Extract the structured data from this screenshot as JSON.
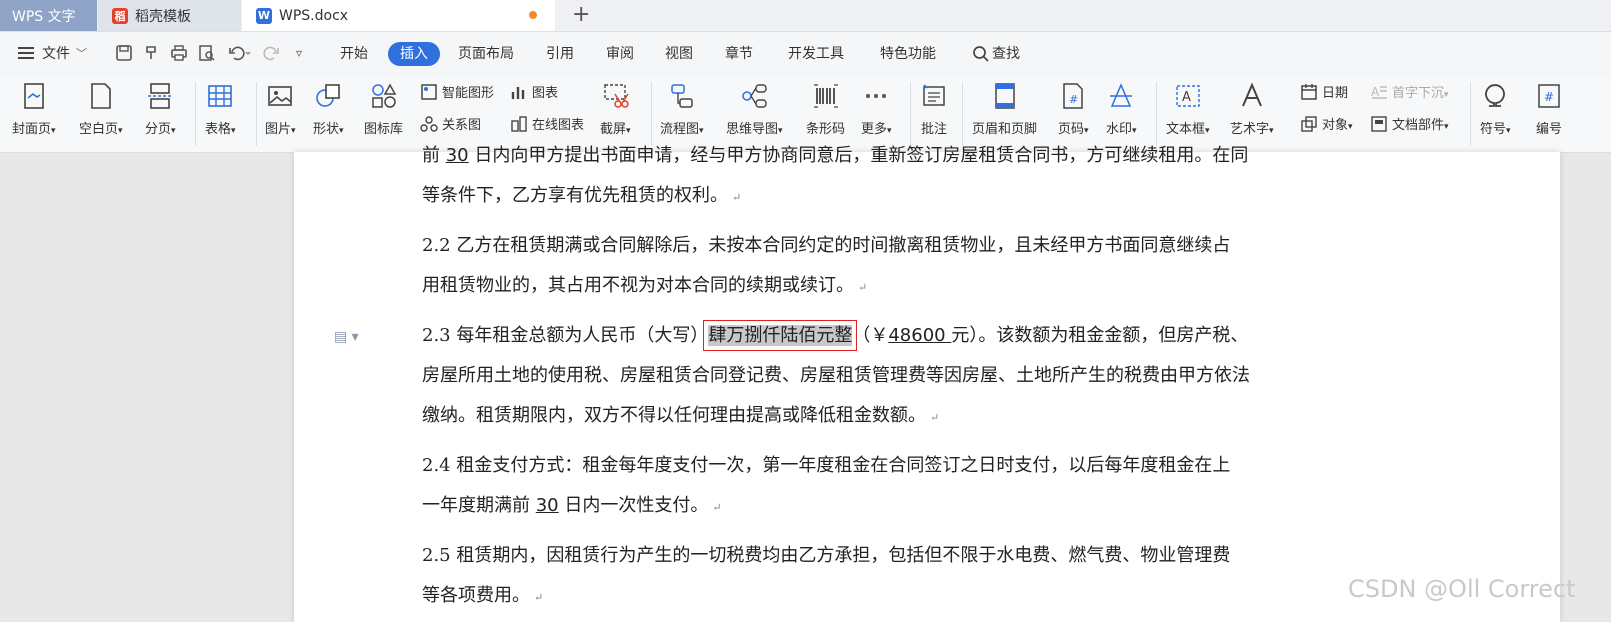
{
  "tabs": {
    "wps": "WPS 文字",
    "template": "稻壳模板",
    "document": "WPS.docx"
  },
  "menubar": {
    "file": "文件",
    "items": [
      "开始",
      "插入",
      "页面布局",
      "引用",
      "审阅",
      "视图",
      "章节",
      "开发工具",
      "特色功能",
      "查找"
    ],
    "active": "插入"
  },
  "ribbon": {
    "cover": "封面页",
    "blank": "空白页",
    "page_break": "分页",
    "table": "表格",
    "picture": "图片",
    "shape": "形状",
    "icon_lib": "图标库",
    "smart_shape": "智能图形",
    "chart": "图表",
    "relation": "关系图",
    "online_chart": "在线图表",
    "screenshot": "截屏",
    "flowchart": "流程图",
    "mindmap": "思维导图",
    "barcode": "条形码",
    "more": "更多",
    "comment": "批注",
    "header_footer": "页眉和页脚",
    "page_number": "页码",
    "watermark": "水印",
    "textbox": "文本框",
    "wordart": "艺术字",
    "date": "日期",
    "dropcap": "首字下沉",
    "object": "对象",
    "doc_parts": "文档部件",
    "symbol": "符号",
    "numbering": "编号"
  },
  "document": {
    "p1_line1_pre": "前 ",
    "p1_line1_num": "30",
    "p1_line1_post": " 日内向甲方提出书面申请，经与甲方协商同意后，重新签订房屋租赁合同书，方可继续租用。在同",
    "p1_line2": "等条件下，乙方享有优先租赁的权利。",
    "p2_line1": "2.2  乙方在租赁期满或合同解除后，未按本合同约定的时间撤离租赁物业，且未经甲方书面同意继续占",
    "p2_line2": "用租赁物业的，其占用不视为对本合同的续期或续订。",
    "p3_prefix": "2.3  每年租金总额为人民币（大写）",
    "p3_highlight": "肆万捌仟陆佰元整",
    "p3_mid": "（￥",
    "p3_amount": "48600 ",
    "p3_suffix": "元）。该数额为租金金额，但房产税、",
    "p3_line2": "房屋所用土地的使用税、房屋租赁合同登记费、房屋租赁管理费等因房屋、土地所产生的税费由甲方依法",
    "p3_line3": "缴纳。租赁期限内，双方不得以任何理由提高或降低租金数额。",
    "p4_line1": "2.4  租金支付方式：租金每年度支付一次，第一年度租金在合同签订之日时支付，以后每年度租金在上",
    "p4_line2_pre": "一年度期满前 ",
    "p4_line2_num": "30",
    "p4_line2_post": " 日内一次性支付。",
    "p5_line1": "2.5  租赁期内，因租赁行为产生的一切税费均由乙方承担，包括但不限于水电费、燃气费、物业管理费",
    "p5_line2": "等各项费用。"
  },
  "watermark": "CSDN @Oll Correct"
}
